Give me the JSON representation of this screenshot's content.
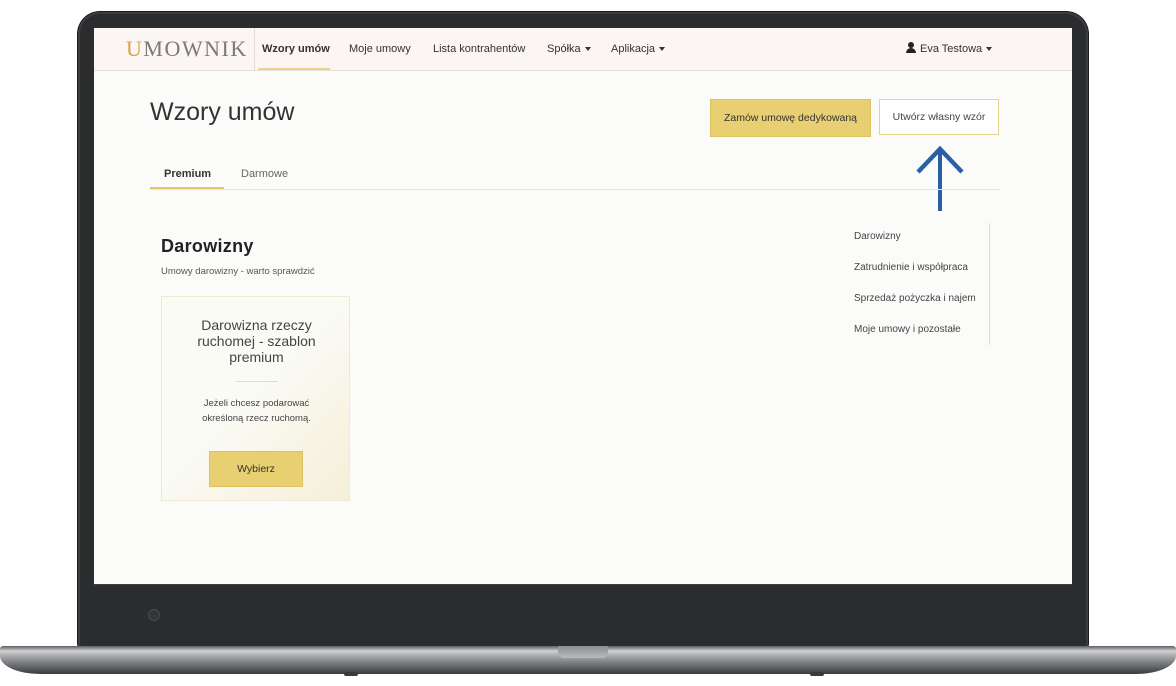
{
  "logo": {
    "initial": "U",
    "rest": "MOWNIK"
  },
  "nav": {
    "items": [
      {
        "label": "Wzory umów",
        "active": true
      },
      {
        "label": "Moje umowy"
      },
      {
        "label": "Lista kontrahentów"
      },
      {
        "label": "Spółka",
        "dropdown": true
      },
      {
        "label": "Aplikacja",
        "dropdown": true
      }
    ],
    "user": "Eva Testowa"
  },
  "page": {
    "title": "Wzory umów",
    "primary_button": "Zamów umowę dedykowaną",
    "secondary_button": "Utwórz własny wzór"
  },
  "tabs": [
    "Premium",
    "Darmowe"
  ],
  "section": {
    "title": "Darowizny",
    "subtitle": "Umowy darowizny - warto sprawdzić"
  },
  "card": {
    "title_lines": [
      "Darowizna rzeczy",
      "ruchomej - szablon",
      "premium"
    ],
    "desc_lines": [
      "Jeżeli chcesz podarować",
      "określoną rzecz ruchomą."
    ],
    "button": "Wybierz"
  },
  "sidenav": [
    "Darowizny",
    "Zatrudnienie i współpraca",
    "Sprzedaż pożyczka i najem",
    "Moje umowy i pozostałe"
  ],
  "colors": {
    "accent": "#e8cf72",
    "arrow": "#2a5ea5",
    "navbar_bg": "#fbf5f4"
  }
}
